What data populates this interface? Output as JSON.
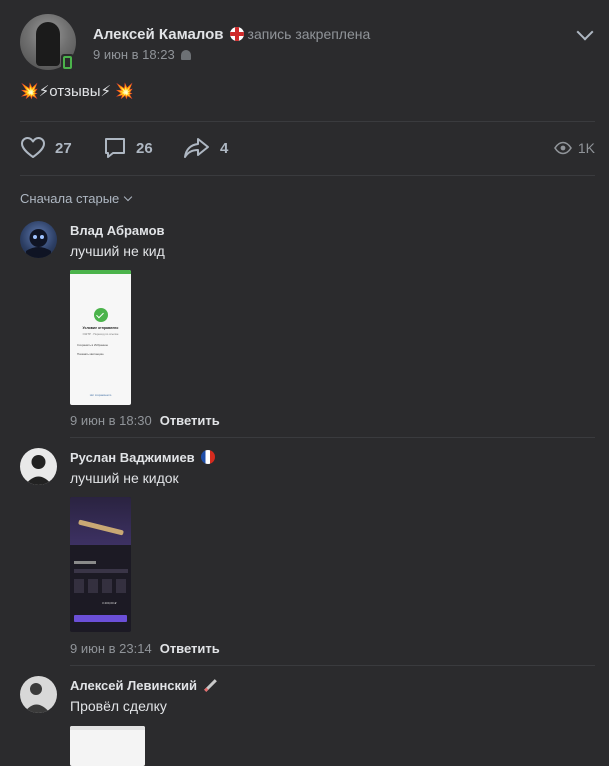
{
  "post": {
    "author_name": "Алексей Камалов",
    "pinned_label": "запись закреплена",
    "date": "9 июн в 18:23",
    "text": "отзывы",
    "likes": "27",
    "comments": "26",
    "shares": "4",
    "views": "1K"
  },
  "comments": {
    "sort_label": "Сначала старые",
    "reply_label": "Ответить",
    "items": [
      {
        "author": "Влад Абрамов",
        "text": "лучший не кид",
        "date": "9 июн в 18:30",
        "screenshot": {
          "title": "Условие отправлено",
          "subtitle": "ОЖТР · Переход по ссылке",
          "row1": "Сохранить в Избранное",
          "row2": "Показать квитанцию",
          "footer": "Нет сохранённого"
        }
      },
      {
        "author": "Руслан Ваджимиев",
        "text": "лучший не кидок",
        "date": "9 июн в 23:14",
        "screenshot": {
          "price": "3 200,00 ₽"
        }
      },
      {
        "author": "Алексей Левинский",
        "text": "Провёл сделку",
        "date": ""
      }
    ]
  },
  "colors": {
    "background": "#2b2b2d",
    "text_primary": "#e1e3e6",
    "text_secondary": "#909499",
    "icon": "#aeb7c2",
    "online": "#4bb34b",
    "success": "#4bb34b"
  },
  "icons": {
    "like": "heart-icon",
    "comment": "comment-icon",
    "share": "share-icon",
    "views": "eye-icon",
    "menu": "chevron-down-icon"
  }
}
